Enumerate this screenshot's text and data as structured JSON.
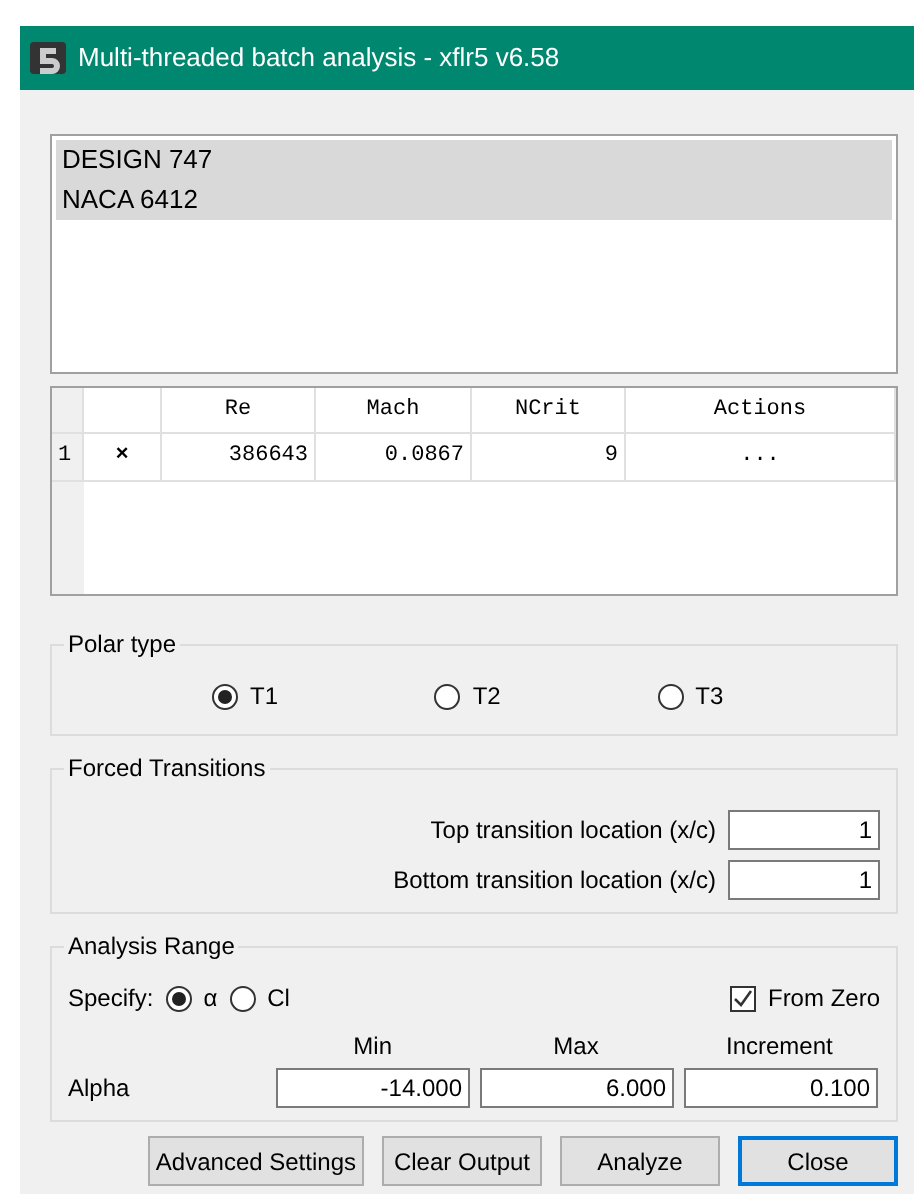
{
  "window": {
    "title": "Multi-threaded batch analysis - xflr5 v6.58"
  },
  "foils": [
    {
      "name": "DESIGN 747",
      "selected": true
    },
    {
      "name": "NACA 6412",
      "selected": true
    }
  ],
  "table": {
    "columns": [
      "Re",
      "Mach",
      "NCrit",
      "Actions"
    ],
    "rows": [
      {
        "index": "1",
        "mark": "×",
        "re": "386643",
        "mach": "0.0867",
        "ncrit": "9",
        "actions": "..."
      }
    ]
  },
  "polar_type": {
    "title": "Polar type",
    "options": [
      {
        "label": "T1",
        "selected": true
      },
      {
        "label": "T2",
        "selected": false
      },
      {
        "label": "T3",
        "selected": false
      }
    ]
  },
  "forced_transitions": {
    "title": "Forced Transitions",
    "fields": [
      {
        "label": "Top transition location (x/c)",
        "value": "1"
      },
      {
        "label": "Bottom transition location (x/c)",
        "value": "1"
      }
    ]
  },
  "analysis_range": {
    "title": "Analysis Range",
    "specify_label": "Specify:",
    "specify_options": [
      {
        "label": "α",
        "selected": true
      },
      {
        "label": "Cl",
        "selected": false
      }
    ],
    "from_zero": {
      "label": "From Zero",
      "checked": true
    },
    "columns": [
      "Min",
      "Max",
      "Increment"
    ],
    "rows": [
      {
        "label": "Alpha",
        "values": [
          "-14.000",
          "6.000",
          "0.100"
        ]
      }
    ]
  },
  "buttons": [
    {
      "label": "Advanced Settings",
      "focused": false
    },
    {
      "label": "Clear Output",
      "focused": false
    },
    {
      "label": "Analyze",
      "focused": false
    },
    {
      "label": "Close",
      "focused": true
    }
  ]
}
